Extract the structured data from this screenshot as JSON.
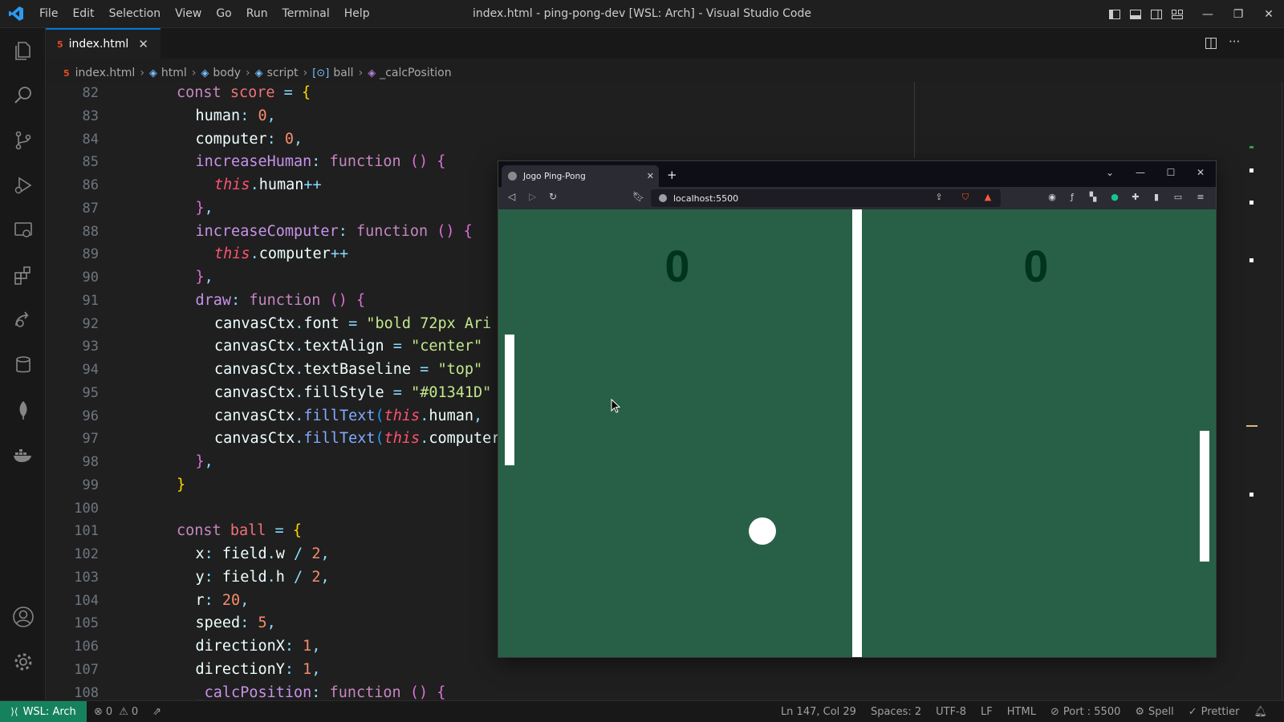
{
  "window": {
    "title": "index.html - ping-pong-dev [WSL: Arch] - Visual Studio Code"
  },
  "menu": [
    "File",
    "Edit",
    "Selection",
    "View",
    "Go",
    "Run",
    "Terminal",
    "Help"
  ],
  "tab": {
    "label": "index.html",
    "close": "✕"
  },
  "breadcrumb": [
    "index.html",
    "html",
    "body",
    "script",
    "ball",
    "_calcPosition"
  ],
  "code_lines": [
    {
      "n": "82",
      "indent": 0
    },
    {
      "n": "83",
      "indent": 1
    },
    {
      "n": "84",
      "indent": 1
    },
    {
      "n": "85",
      "indent": 1
    },
    {
      "n": "86",
      "indent": 2
    },
    {
      "n": "87",
      "indent": 1
    },
    {
      "n": "88",
      "indent": 1
    },
    {
      "n": "89",
      "indent": 2
    },
    {
      "n": "90",
      "indent": 1
    },
    {
      "n": "91",
      "indent": 1
    },
    {
      "n": "92",
      "indent": 2
    },
    {
      "n": "93",
      "indent": 2
    },
    {
      "n": "94",
      "indent": 2
    },
    {
      "n": "95",
      "indent": 2
    },
    {
      "n": "96",
      "indent": 2
    },
    {
      "n": "97",
      "indent": 2
    },
    {
      "n": "98",
      "indent": 1
    },
    {
      "n": "99",
      "indent": 0
    },
    {
      "n": "100",
      "indent": 0
    },
    {
      "n": "101",
      "indent": 0
    },
    {
      "n": "102",
      "indent": 1
    },
    {
      "n": "103",
      "indent": 1
    },
    {
      "n": "104",
      "indent": 1
    },
    {
      "n": "105",
      "indent": 1
    },
    {
      "n": "106",
      "indent": 1
    },
    {
      "n": "107",
      "indent": 1
    },
    {
      "n": "108",
      "indent": 1
    }
  ],
  "code_tokens": [
    [
      [
        "k",
        "const "
      ],
      [
        "n",
        "score"
      ],
      [
        "p",
        " = "
      ],
      [
        "br1",
        "{"
      ]
    ],
    [
      [
        "prop",
        "human"
      ],
      [
        "p",
        ": "
      ],
      [
        "num",
        "0"
      ],
      [
        "p",
        ","
      ]
    ],
    [
      [
        "prop",
        "computer"
      ],
      [
        "p",
        ": "
      ],
      [
        "num",
        "0"
      ],
      [
        "p",
        ","
      ]
    ],
    [
      [
        "fn",
        "increaseHuman"
      ],
      [
        "p",
        ": "
      ],
      [
        "k",
        "function"
      ],
      [
        "p",
        " "
      ],
      [
        "br2",
        "()"
      ],
      [
        "p",
        " "
      ],
      [
        "br2",
        "{"
      ]
    ],
    [
      [
        "t",
        "this"
      ],
      [
        "p",
        "."
      ],
      [
        "prop",
        "human"
      ],
      [
        "p",
        "++"
      ]
    ],
    [
      [
        "br2",
        "}"
      ],
      [
        "p",
        ","
      ]
    ],
    [
      [
        "fn",
        "increaseComputer"
      ],
      [
        "p",
        ": "
      ],
      [
        "k",
        "function"
      ],
      [
        "p",
        " "
      ],
      [
        "br2",
        "()"
      ],
      [
        "p",
        " "
      ],
      [
        "br2",
        "{"
      ]
    ],
    [
      [
        "t",
        "this"
      ],
      [
        "p",
        "."
      ],
      [
        "prop",
        "computer"
      ],
      [
        "p",
        "++"
      ]
    ],
    [
      [
        "br2",
        "}"
      ],
      [
        "p",
        ","
      ]
    ],
    [
      [
        "fn",
        "draw"
      ],
      [
        "p",
        ": "
      ],
      [
        "k",
        "function"
      ],
      [
        "p",
        " "
      ],
      [
        "br2",
        "()"
      ],
      [
        "p",
        " "
      ],
      [
        "br2",
        "{"
      ]
    ],
    [
      [
        "prop",
        "canvasCtx"
      ],
      [
        "p",
        "."
      ],
      [
        "prop",
        "font"
      ],
      [
        "p",
        " = "
      ],
      [
        "s",
        "\"bold 72px Ari"
      ]
    ],
    [
      [
        "prop",
        "canvasCtx"
      ],
      [
        "p",
        "."
      ],
      [
        "prop",
        "textAlign"
      ],
      [
        "p",
        " = "
      ],
      [
        "s",
        "\"center\""
      ]
    ],
    [
      [
        "prop",
        "canvasCtx"
      ],
      [
        "p",
        "."
      ],
      [
        "prop",
        "textBaseline"
      ],
      [
        "p",
        " = "
      ],
      [
        "s",
        "\"top\""
      ]
    ],
    [
      [
        "prop",
        "canvasCtx"
      ],
      [
        "p",
        "."
      ],
      [
        "prop",
        "fillStyle"
      ],
      [
        "p",
        " = "
      ],
      [
        "s",
        "\"#01341D\""
      ]
    ],
    [
      [
        "prop",
        "canvasCtx"
      ],
      [
        "p",
        "."
      ],
      [
        "f",
        "fillText"
      ],
      [
        "br3",
        "("
      ],
      [
        "t",
        "this"
      ],
      [
        "p",
        "."
      ],
      [
        "prop",
        "human"
      ],
      [
        "p",
        ","
      ]
    ],
    [
      [
        "prop",
        "canvasCtx"
      ],
      [
        "p",
        "."
      ],
      [
        "f",
        "fillText"
      ],
      [
        "br3",
        "("
      ],
      [
        "t",
        "this"
      ],
      [
        "p",
        "."
      ],
      [
        "prop",
        "computer"
      ]
    ],
    [
      [
        "br2",
        "}"
      ],
      [
        "p",
        ","
      ]
    ],
    [
      [
        "br1",
        "}"
      ]
    ],
    [],
    [
      [
        "k",
        "const "
      ],
      [
        "n",
        "ball"
      ],
      [
        "p",
        " = "
      ],
      [
        "br1",
        "{"
      ]
    ],
    [
      [
        "prop",
        "x"
      ],
      [
        "p",
        ": "
      ],
      [
        "prop",
        "field"
      ],
      [
        "p",
        "."
      ],
      [
        "prop",
        "w"
      ],
      [
        "p",
        " / "
      ],
      [
        "num",
        "2"
      ],
      [
        "p",
        ","
      ]
    ],
    [
      [
        "prop",
        "y"
      ],
      [
        "p",
        ": "
      ],
      [
        "prop",
        "field"
      ],
      [
        "p",
        "."
      ],
      [
        "prop",
        "h"
      ],
      [
        "p",
        " / "
      ],
      [
        "num",
        "2"
      ],
      [
        "p",
        ","
      ]
    ],
    [
      [
        "prop",
        "r"
      ],
      [
        "p",
        ": "
      ],
      [
        "num",
        "20"
      ],
      [
        "p",
        ","
      ]
    ],
    [
      [
        "prop",
        "speed"
      ],
      [
        "p",
        ": "
      ],
      [
        "num",
        "5"
      ],
      [
        "p",
        ","
      ]
    ],
    [
      [
        "prop",
        "directionX"
      ],
      [
        "p",
        ": "
      ],
      [
        "num",
        "1"
      ],
      [
        "p",
        ","
      ]
    ],
    [
      [
        "prop",
        "directionY"
      ],
      [
        "p",
        ": "
      ],
      [
        "num",
        "1"
      ],
      [
        "p",
        ","
      ]
    ],
    [
      [
        "fn",
        "_calcPosition"
      ],
      [
        "p",
        ": "
      ],
      [
        "k",
        "function"
      ],
      [
        "p",
        " "
      ],
      [
        "br2",
        "()"
      ],
      [
        "p",
        " "
      ],
      [
        "br2",
        "{"
      ]
    ]
  ],
  "browser": {
    "tab_title": "Jogo Ping-Pong",
    "tab_close": "✕",
    "new_tab": "+",
    "url": "localhost:5500",
    "game": {
      "human_score": "0",
      "computer_score": "0"
    }
  },
  "status": {
    "remote": "WSL: Arch",
    "errors": "0",
    "warnings": "0",
    "position": "Ln 147, Col 29",
    "spaces": "Spaces: 2",
    "encoding": "UTF-8",
    "eol": "LF",
    "language": "HTML",
    "port": "Port : 5500",
    "spell": "Spell",
    "prettier": "Prettier"
  },
  "colors": {
    "field": "#286047",
    "score": "#01341d",
    "remote": "#16825d",
    "accent": "#0078d4"
  }
}
